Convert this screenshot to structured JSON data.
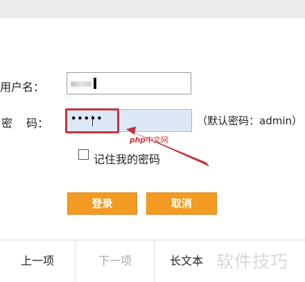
{
  "form": {
    "username_label": "用户名：",
    "password_label_1": "密",
    "password_label_2": "码：",
    "password_value": "•••••",
    "password_hint": "（默认密码：admin）",
    "remember_label": "记住我的密码",
    "remember_checked": false,
    "login_label": "登录",
    "cancel_label": "取消"
  },
  "colors": {
    "button_orange": "#f39a22",
    "highlight_red": "#c8323a",
    "password_bg": "#dde8f7"
  },
  "nav": {
    "prev_label": "上一项",
    "next_label": "下一项",
    "long_text_label": "长文本"
  },
  "watermarks": {
    "php_prefix": "php",
    "php_suffix": "中文网",
    "site": "软件技巧"
  }
}
